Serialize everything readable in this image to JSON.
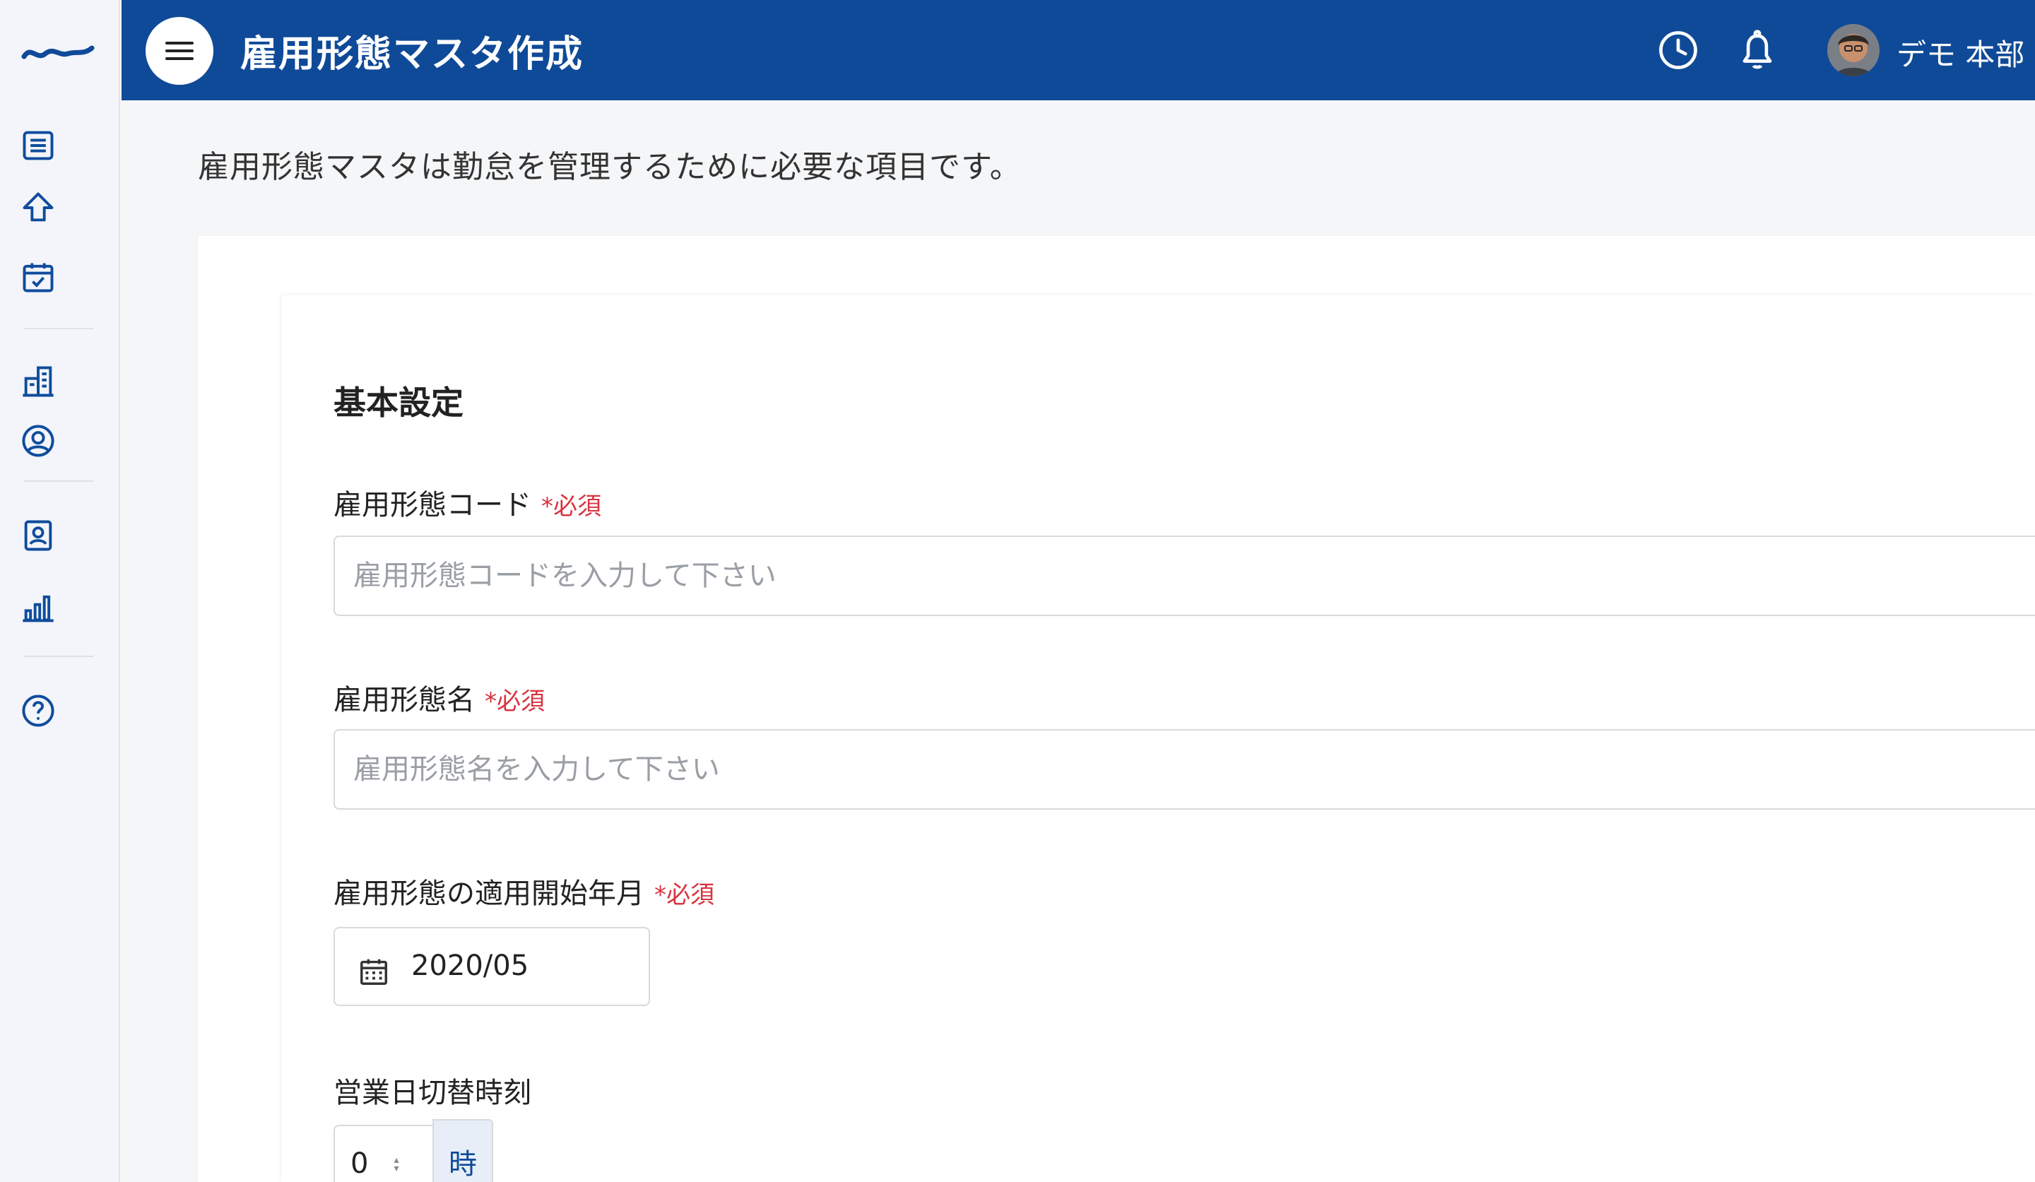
{
  "header": {
    "title": "雇用形態マスタ作成",
    "user_name": "デモ 本部"
  },
  "sidebar": {
    "icons": [
      "list-icon",
      "home-icon",
      "calendar-check-icon",
      "building-icon",
      "user-circle-icon",
      "id-card-icon",
      "bar-chart-icon",
      "help-icon"
    ]
  },
  "main": {
    "intro": "雇用形態マスタは勤怠を管理するために必要な項目です。",
    "section_title": "基本設定",
    "required_mark": "*必須",
    "fields": {
      "code": {
        "label": "雇用形態コード",
        "placeholder": "雇用形態コードを入力して下さい",
        "value": ""
      },
      "name": {
        "label": "雇用形態名",
        "placeholder": "雇用形態名を入力して下さい",
        "value": ""
      },
      "start": {
        "label": "雇用形態の適用開始年月",
        "value": "2020/05"
      },
      "switch_time": {
        "label": "営業日切替時刻",
        "value": "0",
        "unit": "時"
      }
    }
  },
  "colors": {
    "header_bg": "#0f4a98",
    "accent": "#0f4c9c",
    "required": "#d9333f"
  }
}
